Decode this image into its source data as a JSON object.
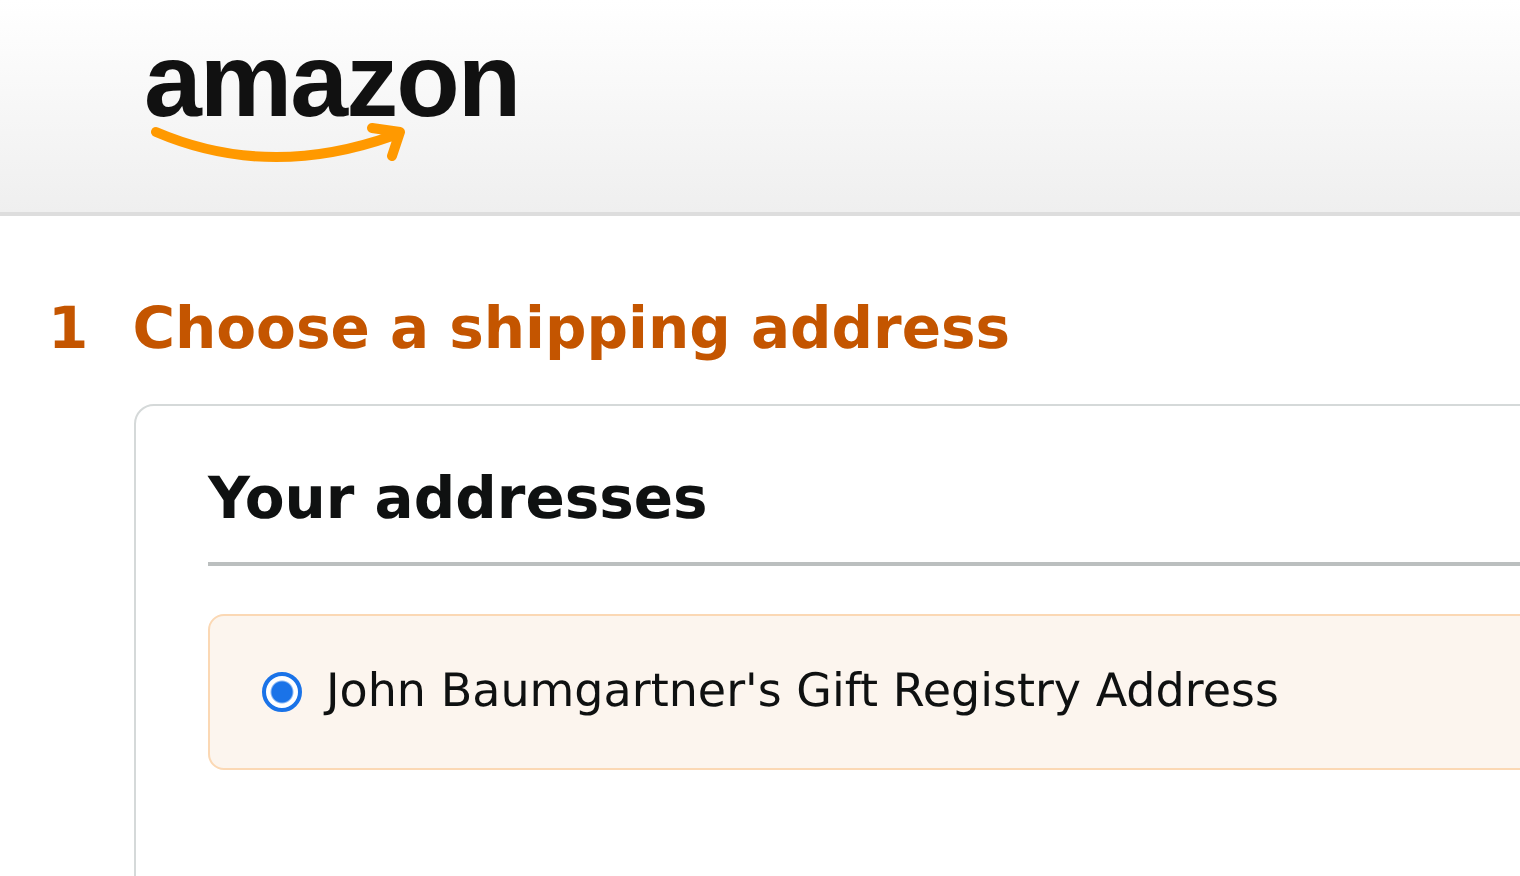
{
  "header": {
    "logo": "amazon"
  },
  "step": {
    "number": "1",
    "title": "Choose a shipping address"
  },
  "addresses": {
    "title": "Your addresses",
    "options": [
      {
        "label": "John Baumgartner's Gift Registry Address",
        "selected": true
      }
    ]
  }
}
